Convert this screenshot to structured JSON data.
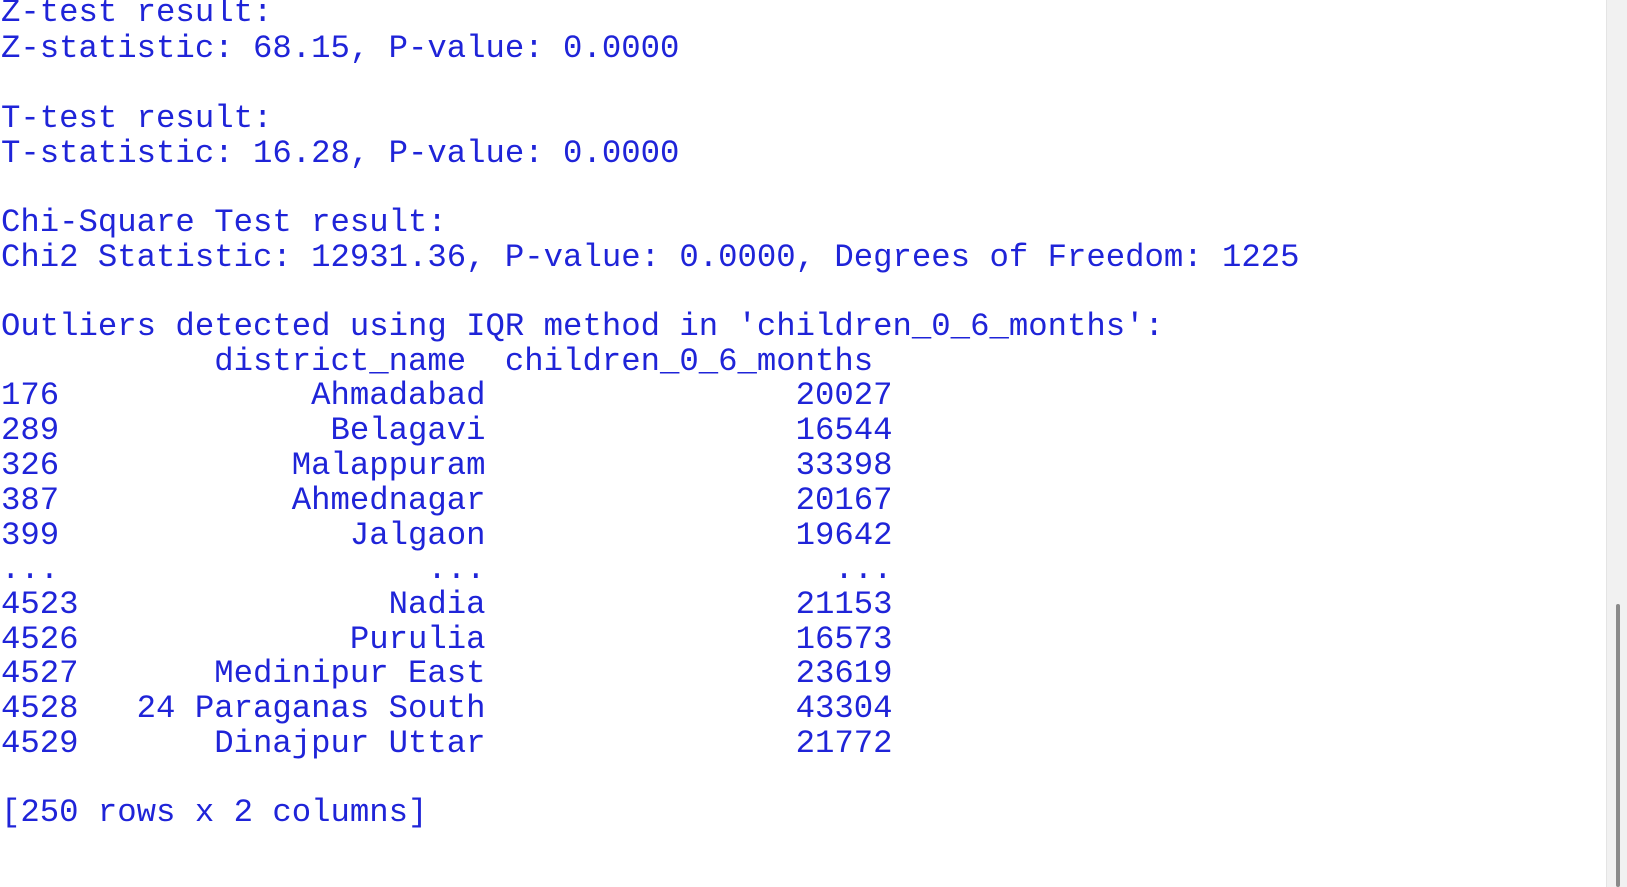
{
  "output": {
    "lines": [
      "Z-test result:",
      "Z-statistic: 68.15, P-value: 0.0000",
      "",
      "T-test result:",
      "T-statistic: 16.28, P-value: 0.0000",
      "",
      "Chi-Square Test result:",
      "Chi2 Statistic: 12931.36, P-value: 0.0000, Degrees of Freedom: 1225",
      "",
      "Outliers detected using IQR method in 'children_0_6_months':",
      "           district_name  children_0_6_months",
      "176             Ahmadabad                20027",
      "289              Belagavi                16544",
      "326            Malappuram                33398",
      "387            Ahmednagar                20167",
      "399               Jalgaon                19642",
      "...                   ...                  ...",
      "4523                Nadia                21153",
      "4526              Purulia                16573",
      "4527       Medinipur East                23619",
      "4528   24 Paraganas South                43304",
      "4529       Dinajpur Uttar                21772",
      "",
      "[250 rows x 2 columns]"
    ]
  },
  "colors": {
    "text": "#1f24d8",
    "background": "#ffffff",
    "scrollbar_thumb": "#8a8a8a"
  }
}
